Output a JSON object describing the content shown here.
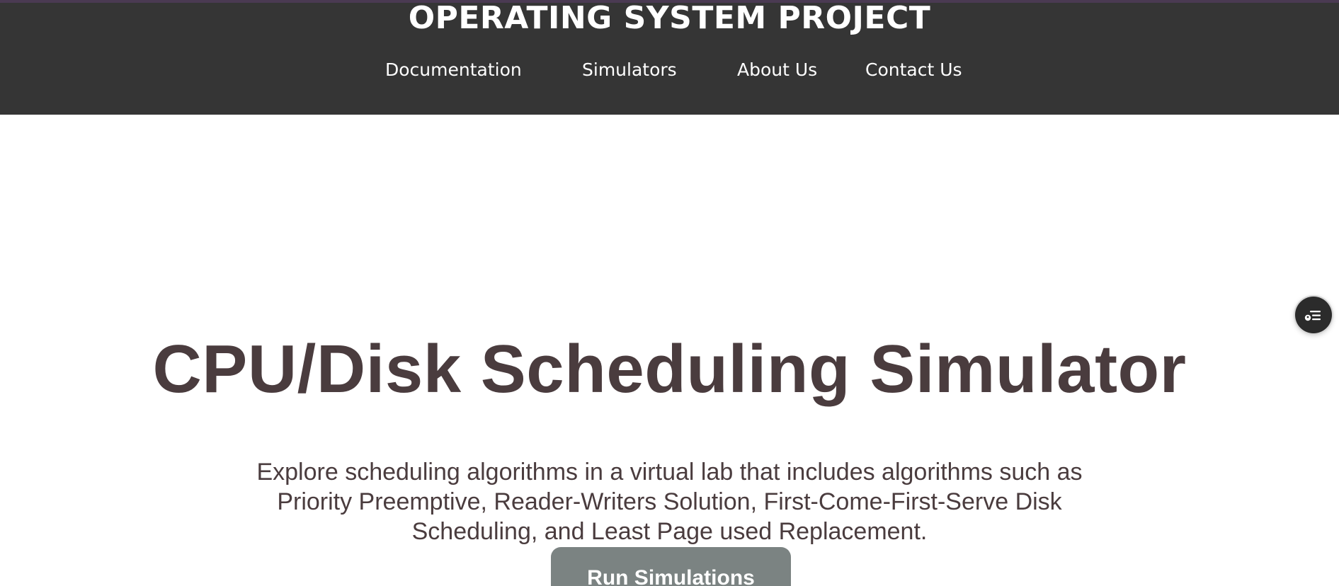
{
  "header": {
    "site_title": "OPERATING SYSTEM PROJECT",
    "nav": {
      "documentation": "Documentation",
      "simulators": "Simulators",
      "about": "About Us",
      "contact": "Contact Us"
    }
  },
  "hero": {
    "title": "CPU/Disk Scheduling Simulator",
    "description": "Explore scheduling algorithms in a virtual lab that includes algorithms such as Priority Preemptive, Reader-Writers Solution, First-Come-First-Serve Disk Scheduling, and Least Page used Replacement.",
    "button_label": "Run Simulations"
  },
  "widget": {
    "icon": "user-list-icon"
  },
  "colors": {
    "header_bg": "#353535",
    "top_accent": "#4a3a52",
    "text_dark": "#4a3c3e",
    "button_bg": "#7b8382"
  }
}
